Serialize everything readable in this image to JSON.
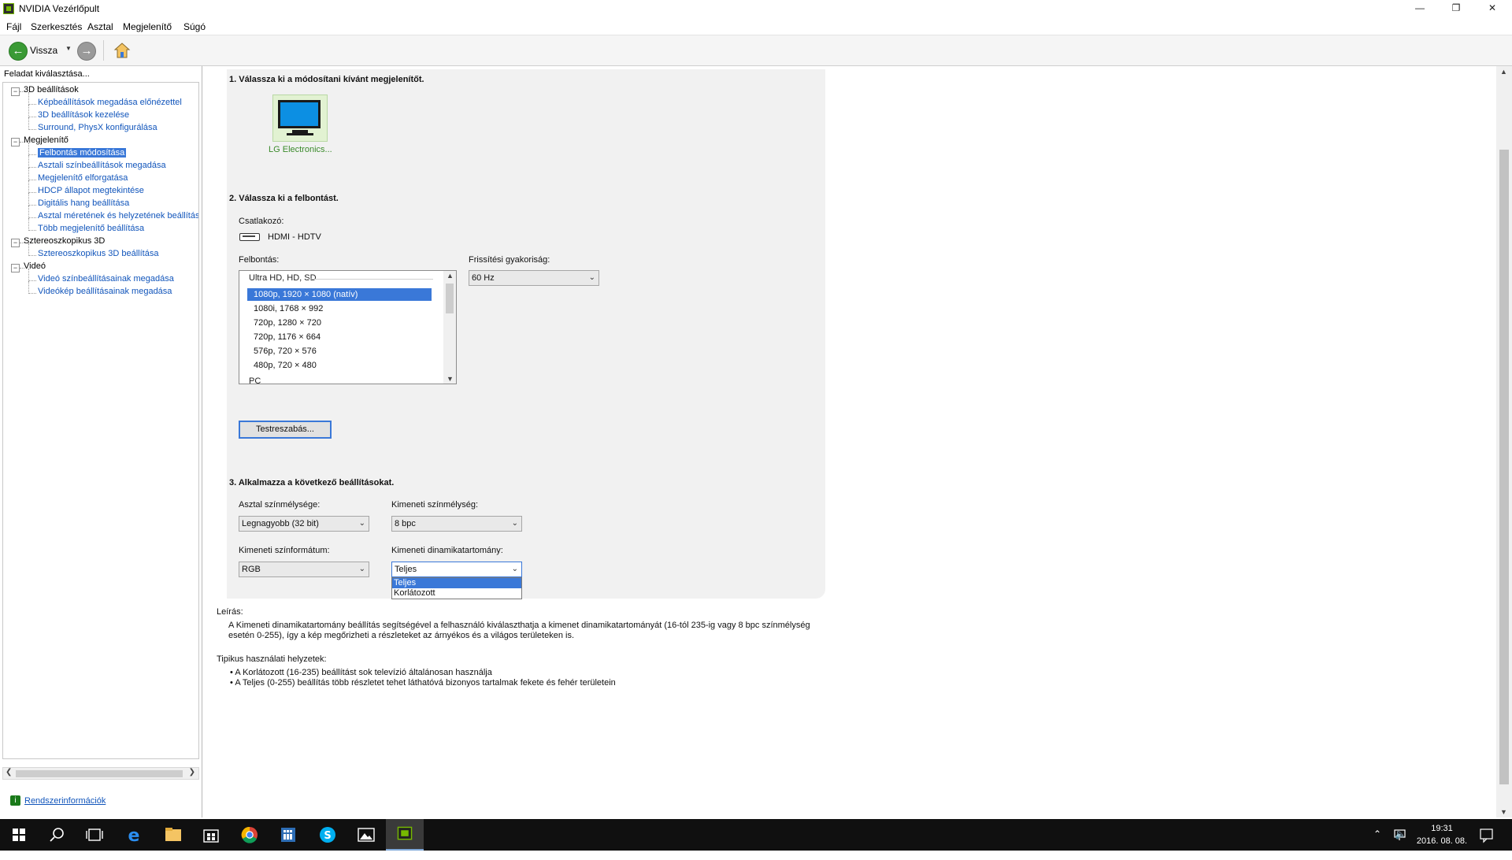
{
  "window": {
    "title": "NVIDIA Vezérlőpult"
  },
  "menu": [
    "Fájl",
    "Szerkesztés",
    "Asztal",
    "Megjelenítő",
    "Súgó"
  ],
  "toolbar": {
    "back_label": "Vissza"
  },
  "left": {
    "header": "Feladat kiválasztása...",
    "tree": [
      {
        "label": "3D beállítások",
        "level": 0
      },
      {
        "label": "Képbeállítások megadása előnézettel",
        "level": 1
      },
      {
        "label": "3D beállítások kezelése",
        "level": 1
      },
      {
        "label": "Surround, PhysX konfigurálása",
        "level": 1
      },
      {
        "label": "Megjelenítő",
        "level": 0
      },
      {
        "label": "Felbontás módosítása",
        "level": 1,
        "selected": true
      },
      {
        "label": "Asztali színbeállítások megadása",
        "level": 1
      },
      {
        "label": "Megjelenítő elforgatása",
        "level": 1
      },
      {
        "label": "HDCP állapot megtekintése",
        "level": 1
      },
      {
        "label": "Digitális hang beállítása",
        "level": 1
      },
      {
        "label": "Asztal méretének és helyzetének beállítása",
        "level": 1
      },
      {
        "label": "Több megjelenítő beállítása",
        "level": 1
      },
      {
        "label": "Sztereoszkopikus 3D",
        "level": 0
      },
      {
        "label": "Sztereoszkopikus 3D beállítása",
        "level": 1
      },
      {
        "label": "Videó",
        "level": 0
      },
      {
        "label": "Videó színbeállításainak megadása",
        "level": 1
      },
      {
        "label": "Videókép beállításainak megadása",
        "level": 1
      }
    ],
    "sysinfo": "Rendszerinformációk"
  },
  "step1": {
    "title": "1. Válassza ki a módosítani kívánt megjelenítőt.",
    "display_name": "LG Electronics..."
  },
  "step2": {
    "title": "2. Válassza ki a felbontást.",
    "connector_label": "Csatlakozó:",
    "connector_value": "HDMI - HDTV",
    "resolution_label": "Felbontás:",
    "group_label": "Ultra HD, HD, SD",
    "resolutions": [
      "1080p, 1920 × 1080 (natív)",
      "1080i, 1768 × 992",
      "720p, 1280 × 720",
      "720p, 1176 × 664",
      "576p, 720 × 576",
      "480p, 720 × 480"
    ],
    "next_group_partial": "PC",
    "refresh_label": "Frissítési gyakoriság:",
    "refresh_value": "60 Hz",
    "customize_button": "Testreszabás..."
  },
  "step3": {
    "title": "3. Alkalmazza a következő beállításokat.",
    "desktop_depth_label": "Asztal színmélysége:",
    "desktop_depth_value": "Legnagyobb (32 bit)",
    "output_depth_label": "Kimeneti színmélység:",
    "output_depth_value": "8 bpc",
    "output_format_label": "Kimeneti színformátum:",
    "output_format_value": "RGB",
    "dynamic_range_label": "Kimeneti dinamikatartomány:",
    "dynamic_range_value": "Teljes",
    "dynamic_range_options": [
      "Teljes",
      "Korlátozott"
    ]
  },
  "description": {
    "label": "Leírás:",
    "line1": "A Kimeneti dinamikatartomány beállítás segítségével a felhasználó kiválaszthatja a kimenet dinamikatartományát (16-tól 235-ig vagy 8 bpc színmélység",
    "line2": "esetén 0-255), így a kép megőrizheti a részleteket az árnyékos és a világos területeken is."
  },
  "usage": {
    "label": "Tipikus használati helyzetek:",
    "items": [
      "A Korlátozott (16-235) beállítást sok televízió általánosan használja",
      "A Teljes (0-255) beállítás több részletet tehet láthatóvá bizonyos tartalmak fekete és fehér területein"
    ]
  },
  "taskbar": {
    "time": "19:31",
    "date": "2016. 08. 08."
  },
  "colors": {
    "selection": "#3a78d8",
    "nvidia_green": "#76b900",
    "link": "#1155bb"
  }
}
